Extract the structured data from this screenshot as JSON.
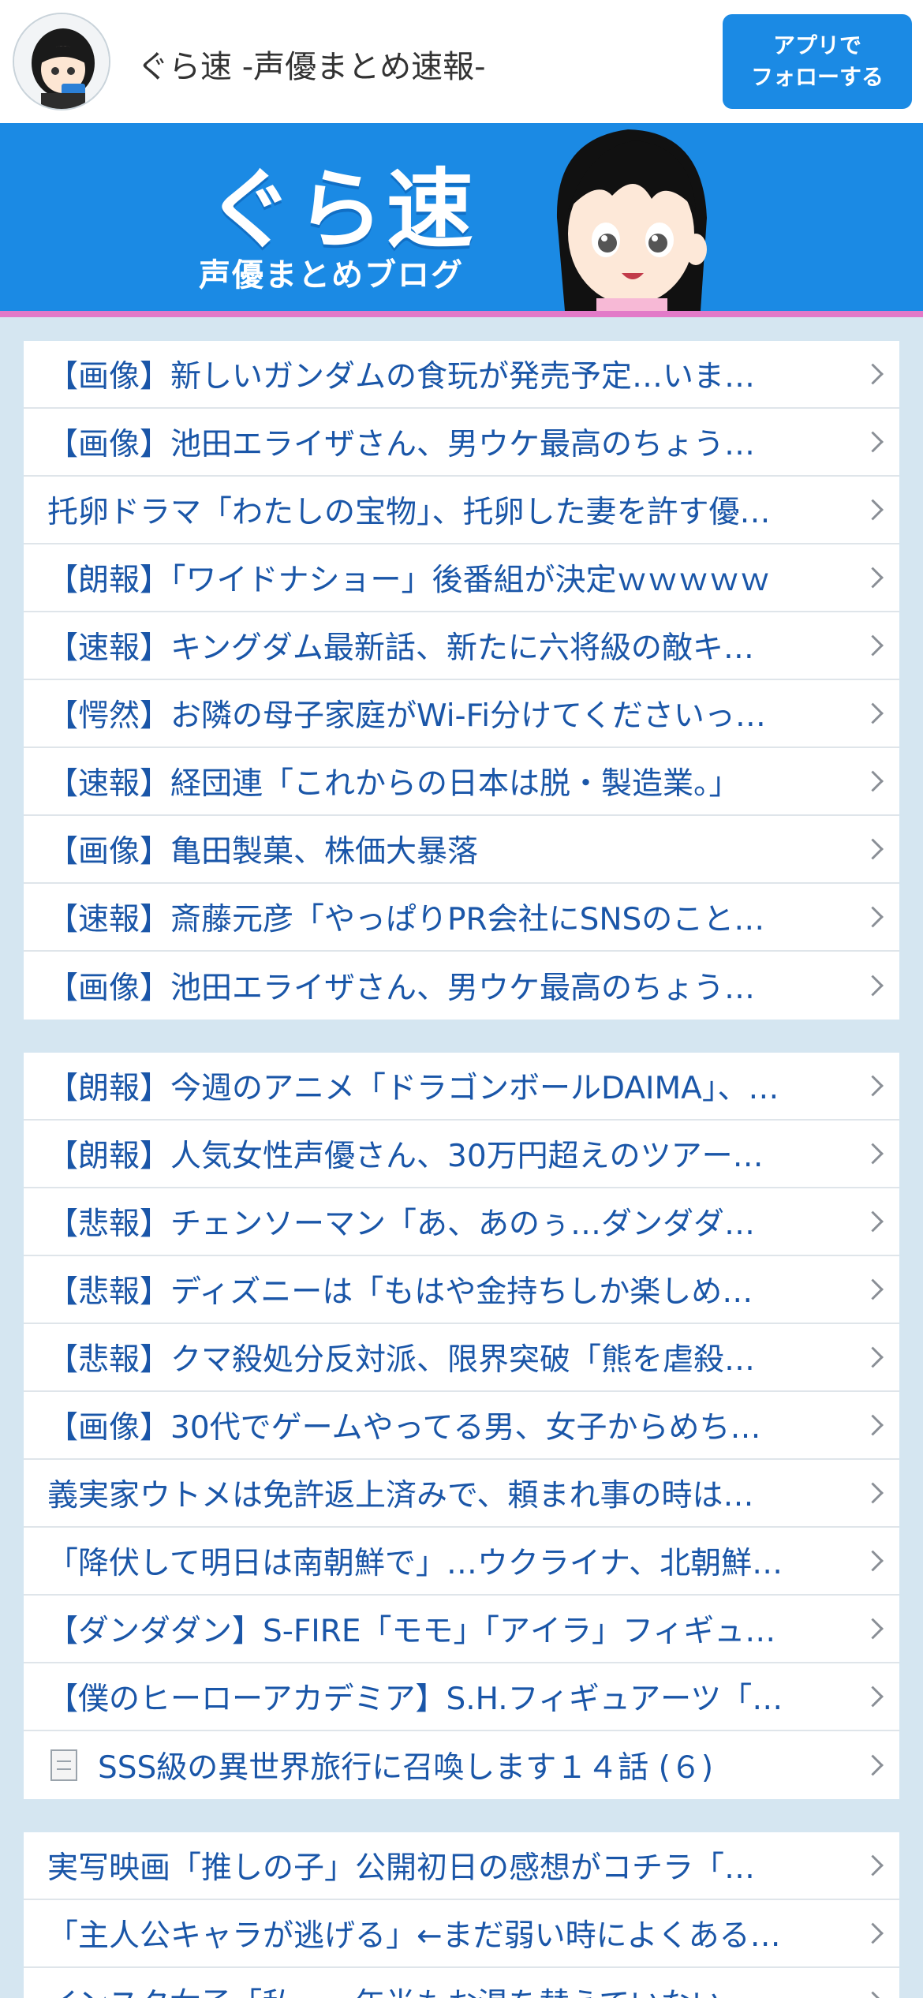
{
  "header": {
    "site_title": "ぐら速 -声優まとめ速報-",
    "follow_button": "アプリで\nフォローする"
  },
  "banner": {
    "logo_main": "ぐら速",
    "logo_sub": "声優まとめブログ"
  },
  "group1": [
    "【画像】新しいガンダムの食玩が発売予定…いま…",
    "【画像】池田エライザさん、男ウケ最高のちょう…",
    "托卵ドラマ「わたしの宝物」、托卵した妻を許す優…",
    "【朗報】「ワイドナショー」後番組が決定ｗｗｗｗｗ",
    "【速報】キングダム最新話、新たに六将級の敵キ…",
    "【愕然】お隣の母子家庭がWi-Fi分けてくださいっ…",
    "【速報】経団連「これからの日本は脱・製造業。」",
    "【画像】亀田製菓、株価大暴落",
    "【速報】斎藤元彦「やっぱりPR会社にSNSのこと…",
    "【画像】池田エライザさん、男ウケ最高のちょう…"
  ],
  "group2": [
    "【朗報】今週のアニメ「ドラゴンボールDAIMA」、…",
    "【朗報】人気女性声優さん、30万円超えのツアー…",
    "【悲報】チェンソーマン「あ、あのぅ…ダンダダ…",
    "【悲報】ディズニーは「もはや金持ちしか楽しめ…",
    "【悲報】クマ殺処分反対派、限界突破「熊を虐殺…",
    "【画像】30代でゲームやってる男、女子からめち…",
    "義実家ウトメは免許返上済みで、頼まれ事の時は…",
    "「降伏して明日は南朝鮮で」…ウクライナ、北朝鮮…",
    "【ダンダダン】S-FIRE「モモ」「アイラ」フィギュ…",
    "【僕のヒーローアカデミア】S.H.フィギュアーツ「…"
  ],
  "group2_doc_item": "SSS級の異世界旅行に召喚します１４話 (６)",
  "group3": [
    "実写映画「推しの子」公開初日の感想がコチラ「…",
    "「主人公キャラが逃げる」←まだ弱い時によくある…",
    "インスタ女子「私、一年半もお湯を替えていない…"
  ],
  "icons": {
    "chevron": "chevron-right-icon",
    "document": "document-icon"
  },
  "colors": {
    "brand_blue": "#1b8ae4",
    "link_text": "#1a56a8",
    "page_bg": "#d5e6f1",
    "banner_stripe": "#e27ac8"
  }
}
